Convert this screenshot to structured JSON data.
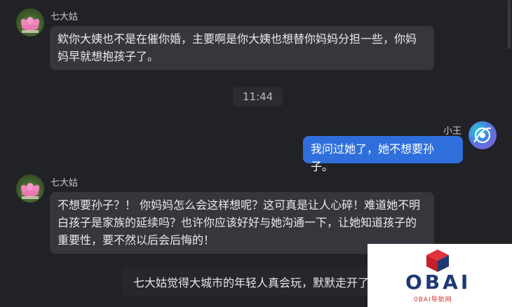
{
  "messages": [
    {
      "sender": "七大姑",
      "text": "欸你大姨也不是在催你婚，主要啊是你大姨也想替你妈妈分担一些，你妈妈早就想抱孩子了。"
    },
    {
      "time": "11:44"
    },
    {
      "sender": "小王",
      "text": "我问过她了，她不想要孙子。"
    },
    {
      "sender": "七大姑",
      "text": "不想要孙子？！ 你妈妈怎么会这样想呢？这可真是让人心碎！难道她不明白孩子是家族的延续吗？也许你应该好好与她沟通一下，让她知道孩子的重要性，要不然以后会后悔的！"
    }
  ],
  "notice": "七大姑觉得大城市的年轻人真会玩，默默走开了",
  "avatars": {
    "aunt": "lotus-avatar",
    "user": "bot-avatar"
  },
  "watermark": {
    "brand": "OBAI",
    "subtitle": "0BAI导航网"
  },
  "colors": {
    "background": "#212226",
    "incoming_bubble": "#36373d",
    "outgoing_bubble": "#2f6fdc"
  }
}
